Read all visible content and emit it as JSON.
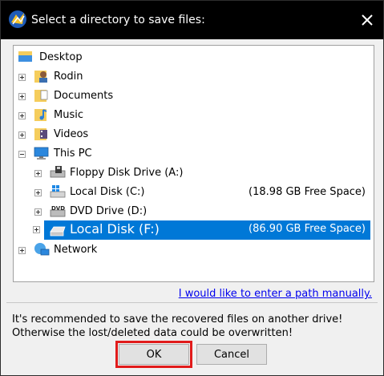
{
  "dialog": {
    "title": "Select a directory to save files:",
    "close_icon": "close-icon",
    "app_icon": "minitool-app-icon"
  },
  "tree": {
    "items": [
      {
        "label": "Desktop",
        "icon": "desktop-folder-icon"
      },
      {
        "label": "Rodin",
        "icon": "user-folder-icon"
      },
      {
        "label": "Documents",
        "icon": "documents-folder-icon"
      },
      {
        "label": "Music",
        "icon": "music-folder-icon"
      },
      {
        "label": "Videos",
        "icon": "videos-folder-icon"
      },
      {
        "label": "This PC",
        "icon": "computer-icon"
      },
      {
        "label": "Floppy Disk Drive (A:)",
        "icon": "floppy-drive-icon"
      },
      {
        "label": "Local Disk (C:)",
        "icon": "windows-drive-icon",
        "free": "(18.98 GB Free Space)"
      },
      {
        "label": "DVD Drive (D:)",
        "icon": "dvd-drive-icon"
      },
      {
        "label": "Local Disk (F:)",
        "icon": "disk-drive-icon",
        "free": "(86.90 GB Free Space)",
        "selected": true
      },
      {
        "label": "Network",
        "icon": "network-icon"
      }
    ]
  },
  "manual_path_link": "I would like to enter a path manually.",
  "warning_text": "It's recommended to save the recovered files on another drive! Otherwise the lost/deleted data could be overwritten!",
  "buttons": {
    "ok": "OK",
    "cancel": "Cancel"
  },
  "colors": {
    "titlebar": "#000000",
    "selection": "#0078d7",
    "link": "#0000ee",
    "highlight_box": "#e11b1b"
  }
}
